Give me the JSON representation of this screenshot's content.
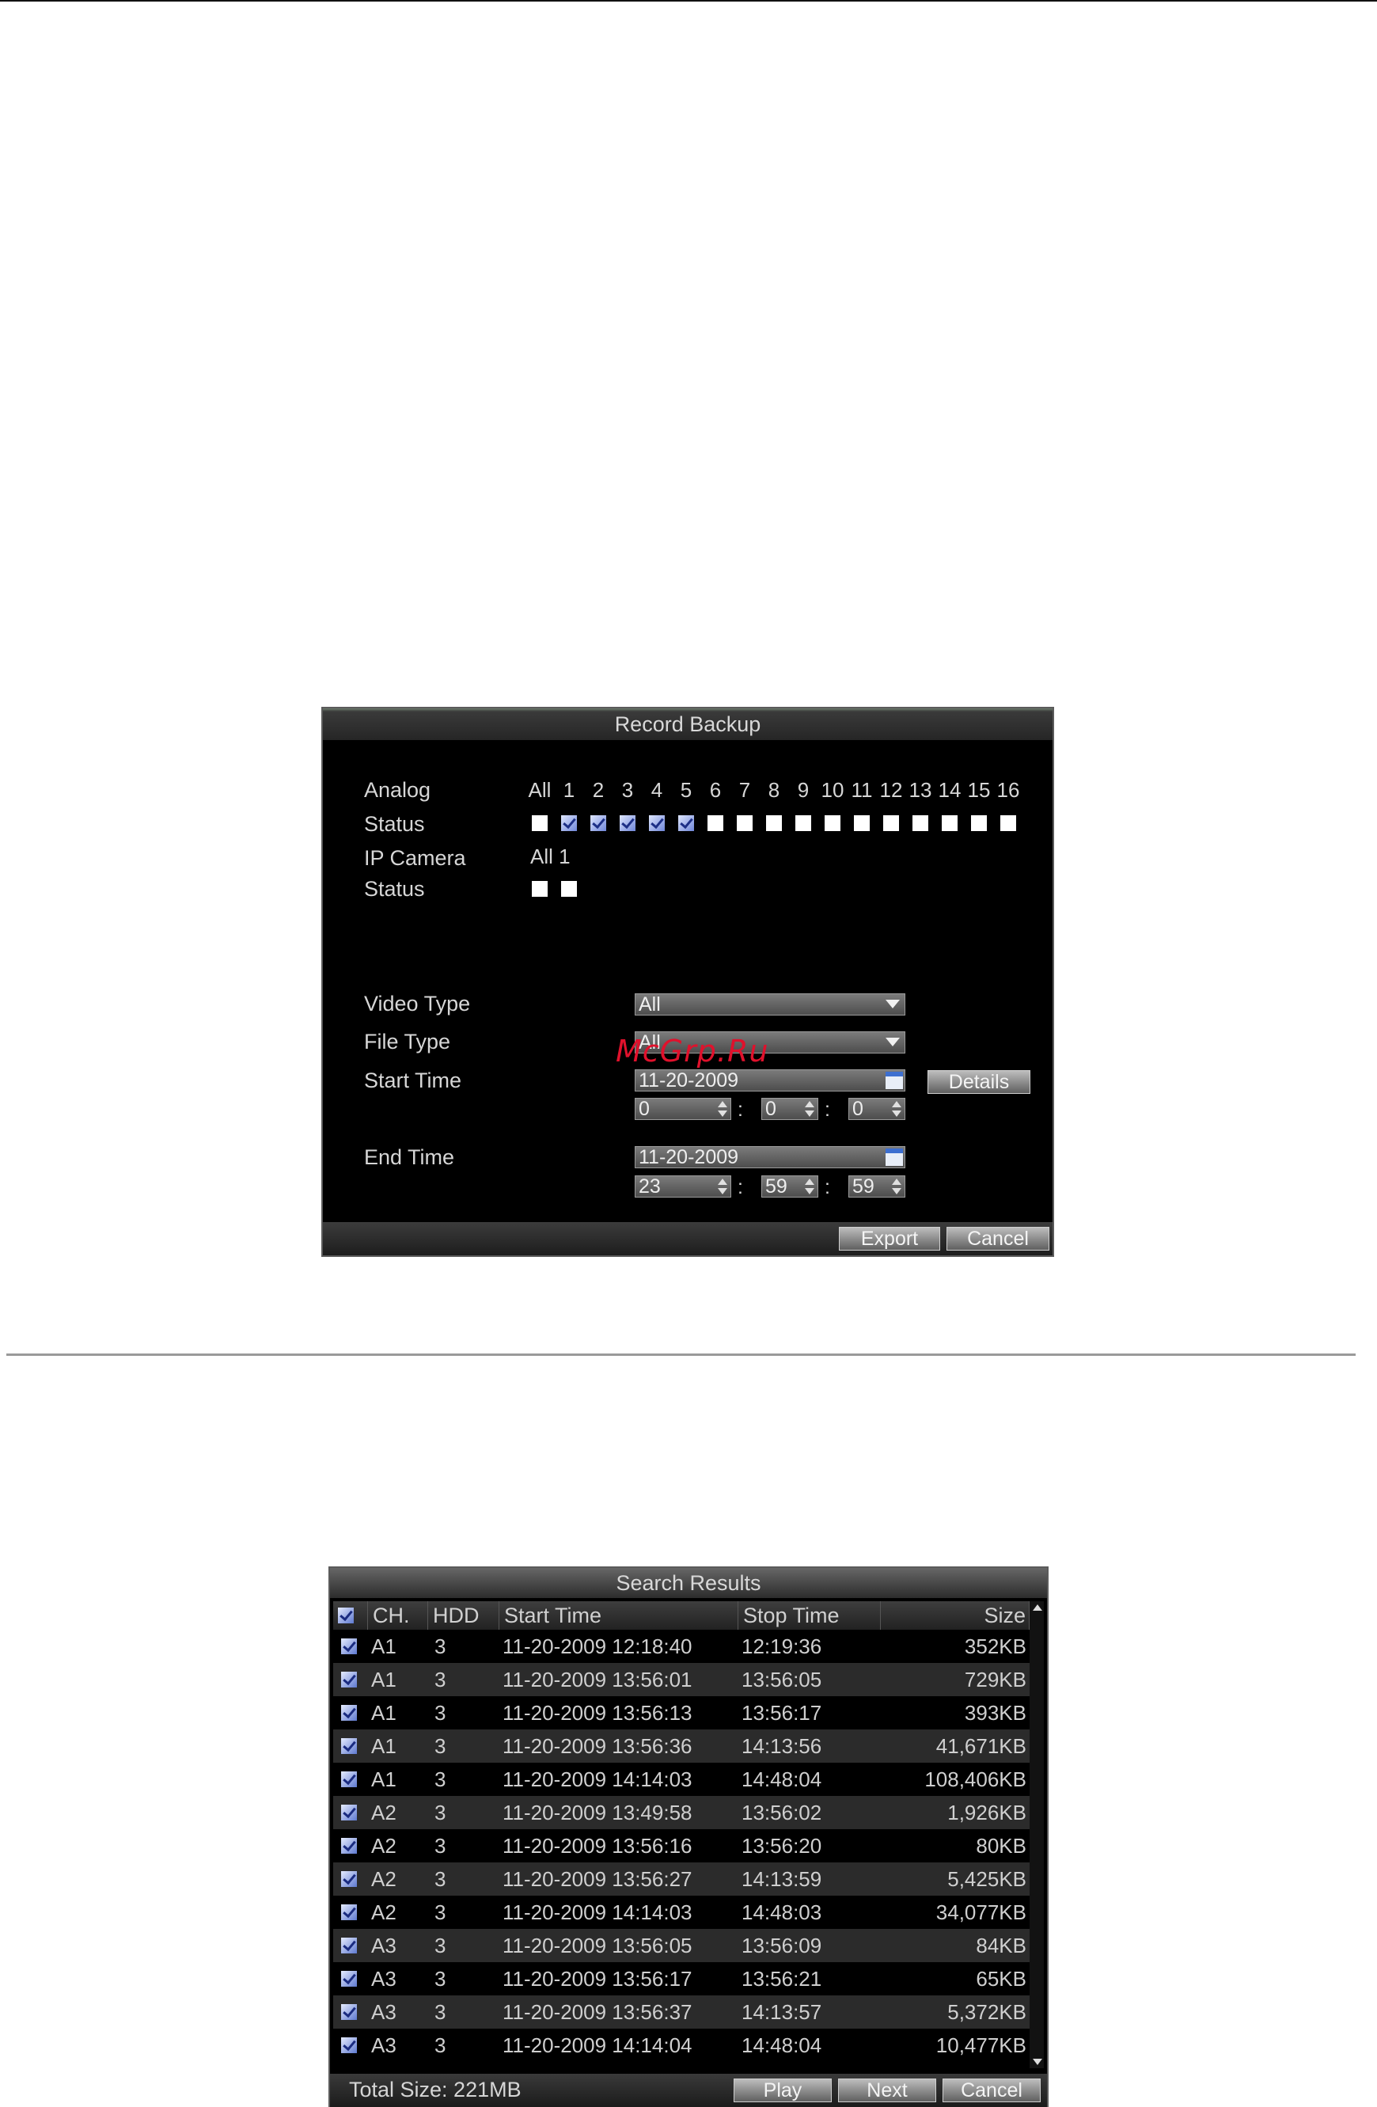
{
  "record_backup": {
    "title": "Record Backup",
    "analog_label": "Analog",
    "status_label": "Status",
    "ip_camera_label": "IP Camera",
    "ip_status_label": "Status",
    "analog_channels": [
      "All",
      "1",
      "2",
      "3",
      "4",
      "5",
      "6",
      "7",
      "8",
      "9",
      "10",
      "11",
      "12",
      "13",
      "14",
      "15",
      "16"
    ],
    "analog_checked": [
      false,
      true,
      true,
      true,
      true,
      true,
      false,
      false,
      false,
      false,
      false,
      false,
      false,
      false,
      false,
      false,
      false
    ],
    "ip_channels_text": "All 1",
    "ip_checked": [
      false,
      false
    ],
    "video_type_label": "Video Type",
    "video_type_value": "All",
    "file_type_label": "File Type",
    "file_type_value": "All",
    "start_time_label": "Start Time",
    "start_date": "11-20-2009",
    "start_h": "0",
    "start_m": "0",
    "start_s": "0",
    "details_button": "Details",
    "end_time_label": "End Time",
    "end_date": "11-20-2009",
    "end_h": "23",
    "end_m": "59",
    "end_s": "59",
    "export_button": "Export",
    "cancel_button": "Cancel"
  },
  "watermark": "McGrp.Ru",
  "search_results": {
    "title": "Search Results",
    "columns": {
      "ch": "CH.",
      "hdd": "HDD",
      "start": "Start Time",
      "stop": "Stop Time",
      "size": "Size"
    },
    "rows": [
      {
        "ch": "A1",
        "hdd": "3",
        "start": "11-20-2009 12:18:40",
        "stop": "12:19:36",
        "size": "352KB"
      },
      {
        "ch": "A1",
        "hdd": "3",
        "start": "11-20-2009 13:56:01",
        "stop": "13:56:05",
        "size": "729KB"
      },
      {
        "ch": "A1",
        "hdd": "3",
        "start": "11-20-2009 13:56:13",
        "stop": "13:56:17",
        "size": "393KB"
      },
      {
        "ch": "A1",
        "hdd": "3",
        "start": "11-20-2009 13:56:36",
        "stop": "14:13:56",
        "size": "41,671KB"
      },
      {
        "ch": "A1",
        "hdd": "3",
        "start": "11-20-2009 14:14:03",
        "stop": "14:48:04",
        "size": "108,406KB"
      },
      {
        "ch": "A2",
        "hdd": "3",
        "start": "11-20-2009 13:49:58",
        "stop": "13:56:02",
        "size": "1,926KB"
      },
      {
        "ch": "A2",
        "hdd": "3",
        "start": "11-20-2009 13:56:16",
        "stop": "13:56:20",
        "size": "80KB"
      },
      {
        "ch": "A2",
        "hdd": "3",
        "start": "11-20-2009 13:56:27",
        "stop": "14:13:59",
        "size": "5,425KB"
      },
      {
        "ch": "A2",
        "hdd": "3",
        "start": "11-20-2009 14:14:03",
        "stop": "14:48:03",
        "size": "34,077KB"
      },
      {
        "ch": "A3",
        "hdd": "3",
        "start": "11-20-2009 13:56:05",
        "stop": "13:56:09",
        "size": "84KB"
      },
      {
        "ch": "A3",
        "hdd": "3",
        "start": "11-20-2009 13:56:17",
        "stop": "13:56:21",
        "size": "65KB"
      },
      {
        "ch": "A3",
        "hdd": "3",
        "start": "11-20-2009 13:56:37",
        "stop": "14:13:57",
        "size": "5,372KB"
      },
      {
        "ch": "A3",
        "hdd": "3",
        "start": "11-20-2009 14:14:04",
        "stop": "14:48:04",
        "size": "10,477KB"
      }
    ],
    "total_size": "Total Size: 221MB",
    "play_button": "Play",
    "next_button": "Next",
    "cancel_button": "Cancel"
  }
}
